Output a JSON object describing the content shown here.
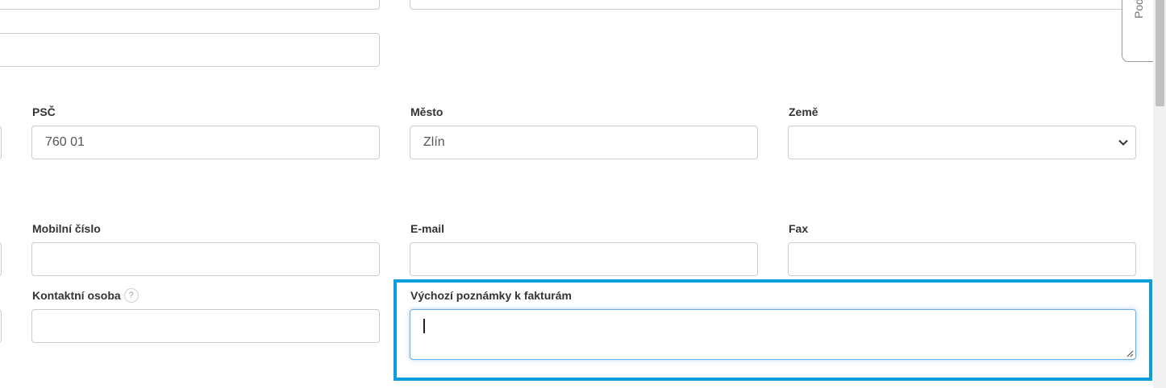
{
  "fields": {
    "psc": {
      "label": "PSČ",
      "value": "760 01"
    },
    "mesto": {
      "label": "Město",
      "value": "Zlín"
    },
    "zeme": {
      "label": "Země",
      "value": ""
    },
    "mobil": {
      "label": "Mobilní číslo",
      "value": ""
    },
    "email": {
      "label": "E-mail",
      "value": ""
    },
    "fax": {
      "label": "Fax",
      "value": ""
    },
    "kontakt": {
      "label": "Kontaktní osoba",
      "help": "?",
      "value": ""
    },
    "poznamky": {
      "label": "Výchozí poznámky k fakturám",
      "value": ""
    }
  },
  "side_tab": {
    "label": "Podp"
  },
  "colors": {
    "highlight": "#0a9fdc",
    "focus": "#66afe9",
    "border": "#cccccc"
  }
}
